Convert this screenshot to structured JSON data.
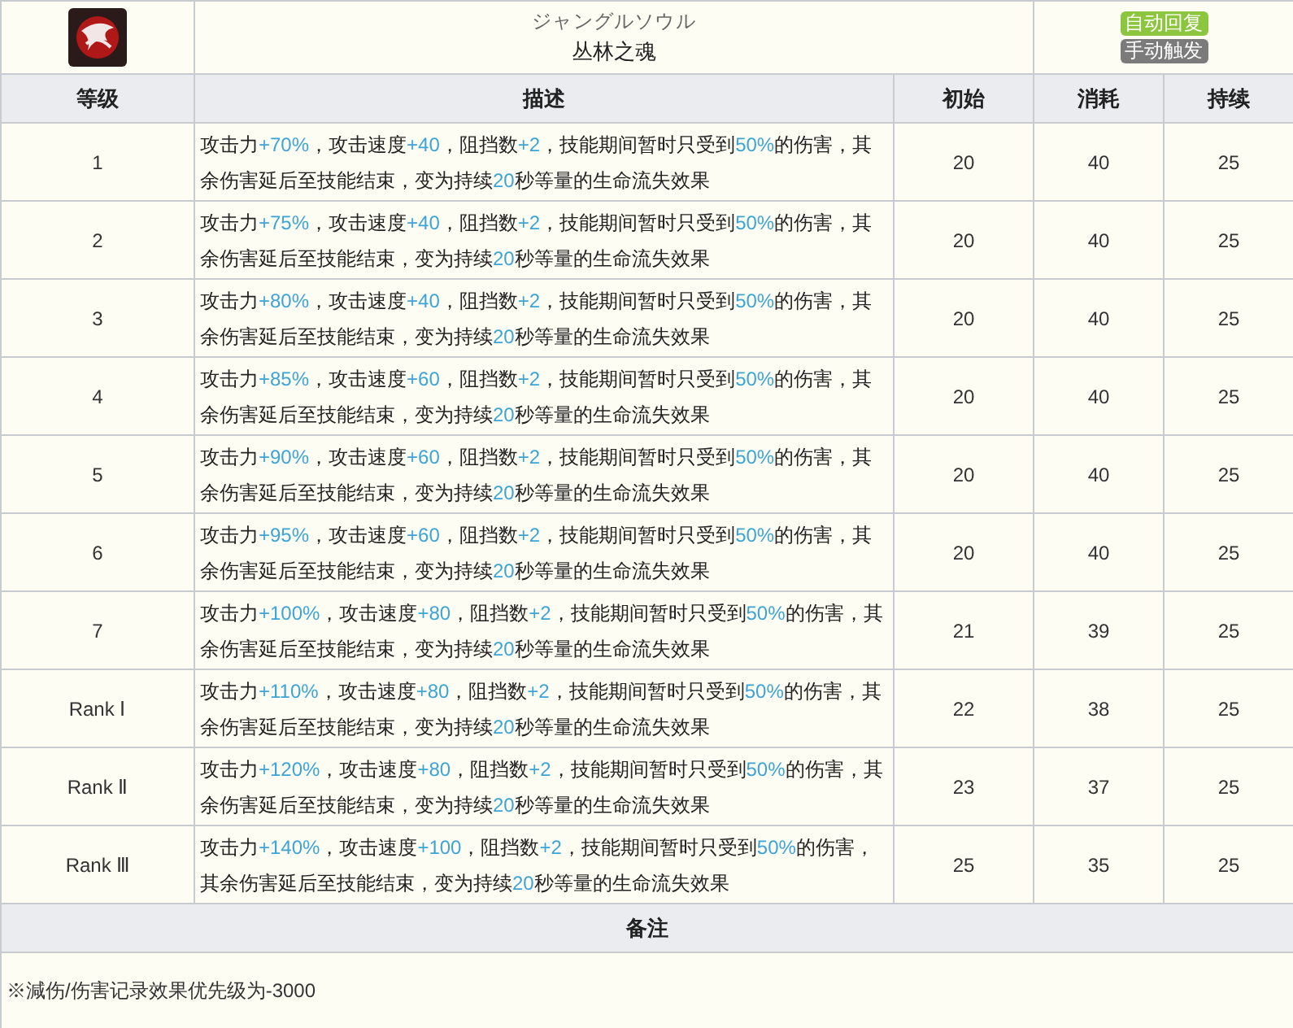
{
  "skill": {
    "name_ja": "ジャングルソウル",
    "name": "丛林之魂",
    "tags": [
      {
        "label": "自动回复",
        "color": "#8cc63f"
      },
      {
        "label": "手动触发",
        "color": "#7b7b7b"
      }
    ]
  },
  "table": {
    "columns": [
      "等级",
      "描述",
      "初始",
      "消耗",
      "持续"
    ],
    "rows": [
      {
        "level": "1",
        "description": [
          "攻击力",
          "+70%",
          "，攻击速度",
          "+40",
          "，阻挡数",
          "+2",
          "，技能期间暂时只受到",
          "50%",
          "的伤害，其余伤害延后至技能结束，变为持续",
          "20",
          "秒等量的生命流失效果"
        ],
        "initial": "20",
        "cost": "40",
        "duration": "25"
      },
      {
        "level": "2",
        "description": [
          "攻击力",
          "+75%",
          "，攻击速度",
          "+40",
          "，阻挡数",
          "+2",
          "，技能期间暂时只受到",
          "50%",
          "的伤害，其余伤害延后至技能结束，变为持续",
          "20",
          "秒等量的生命流失效果"
        ],
        "initial": "20",
        "cost": "40",
        "duration": "25"
      },
      {
        "level": "3",
        "description": [
          "攻击力",
          "+80%",
          "，攻击速度",
          "+40",
          "，阻挡数",
          "+2",
          "，技能期间暂时只受到",
          "50%",
          "的伤害，其余伤害延后至技能结束，变为持续",
          "20",
          "秒等量的生命流失效果"
        ],
        "initial": "20",
        "cost": "40",
        "duration": "25"
      },
      {
        "level": "4",
        "description": [
          "攻击力",
          "+85%",
          "，攻击速度",
          "+60",
          "，阻挡数",
          "+2",
          "，技能期间暂时只受到",
          "50%",
          "的伤害，其余伤害延后至技能结束，变为持续",
          "20",
          "秒等量的生命流失效果"
        ],
        "initial": "20",
        "cost": "40",
        "duration": "25"
      },
      {
        "level": "5",
        "description": [
          "攻击力",
          "+90%",
          "，攻击速度",
          "+60",
          "，阻挡数",
          "+2",
          "，技能期间暂时只受到",
          "50%",
          "的伤害，其余伤害延后至技能结束，变为持续",
          "20",
          "秒等量的生命流失效果"
        ],
        "initial": "20",
        "cost": "40",
        "duration": "25"
      },
      {
        "level": "6",
        "description": [
          "攻击力",
          "+95%",
          "，攻击速度",
          "+60",
          "，阻挡数",
          "+2",
          "，技能期间暂时只受到",
          "50%",
          "的伤害，其余伤害延后至技能结束，变为持续",
          "20",
          "秒等量的生命流失效果"
        ],
        "initial": "20",
        "cost": "40",
        "duration": "25"
      },
      {
        "level": "7",
        "description": [
          "攻击力",
          "+100%",
          "，攻击速度",
          "+80",
          "，阻挡数",
          "+2",
          "，技能期间暂时只受到",
          "50%",
          "的伤害，其余伤害延后至技能结束，变为持续",
          "20",
          "秒等量的生命流失效果"
        ],
        "initial": "21",
        "cost": "39",
        "duration": "25"
      },
      {
        "level": "Rank Ⅰ",
        "description": [
          "攻击力",
          "+110%",
          "，攻击速度",
          "+80",
          "，阻挡数",
          "+2",
          "，技能期间暂时只受到",
          "50%",
          "的伤害，其余伤害延后至技能结束，变为持续",
          "20",
          "秒等量的生命流失效果"
        ],
        "initial": "22",
        "cost": "38",
        "duration": "25"
      },
      {
        "level": "Rank Ⅱ",
        "description": [
          "攻击力",
          "+120%",
          "，攻击速度",
          "+80",
          "，阻挡数",
          "+2",
          "，技能期间暂时只受到",
          "50%",
          "的伤害，其余伤害延后至技能结束，变为持续",
          "20",
          "秒等量的生命流失效果"
        ],
        "initial": "23",
        "cost": "37",
        "duration": "25"
      },
      {
        "level": "Rank Ⅲ",
        "description": [
          "攻击力",
          "+140%",
          "，攻击速度",
          "+100",
          "，阻挡数",
          "+2",
          "，技能期间暂时只受到",
          "50%",
          "的伤害，其余伤害延后至技能结束，变为持续",
          "20",
          "秒等量的生命流失效果"
        ],
        "initial": "25",
        "cost": "35",
        "duration": "25"
      }
    ]
  },
  "notes": {
    "title": "备注",
    "text": "※減伤/伤害记录效果优先级为-3000"
  }
}
